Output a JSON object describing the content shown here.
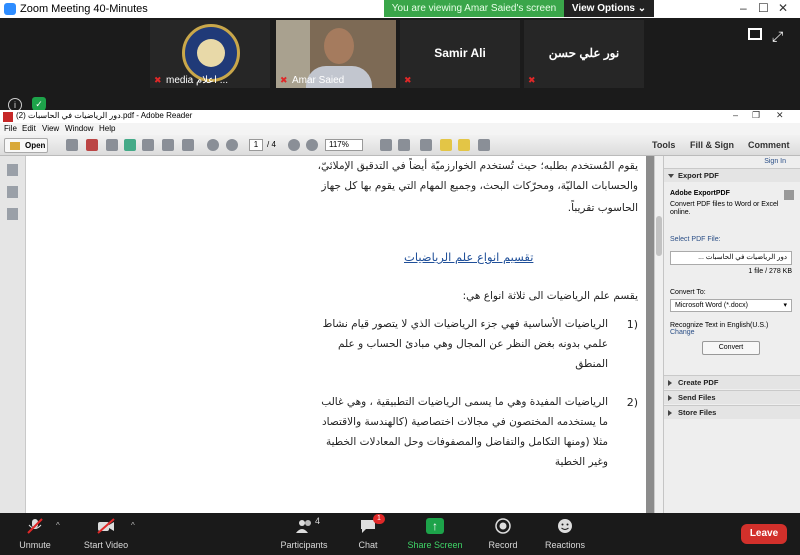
{
  "zoom": {
    "window_title": "Zoom Meeting 40-Minutes",
    "viewing_banner": "You are viewing Amar Saied's screen",
    "view_options": "View Options",
    "participants": [
      {
        "name": "media اعلام ..."
      },
      {
        "name": "Amar Saied"
      },
      {
        "name": "Samir Ali"
      },
      {
        "name": "نور علي حسن"
      }
    ],
    "controls": {
      "unmute": "Unmute",
      "start_video": "Start Video",
      "participants": "Participants",
      "participants_count": "4",
      "chat": "Chat",
      "chat_badge": "1",
      "share_screen": "Share Screen",
      "record": "Record",
      "reactions": "Reactions",
      "leave": "Leave"
    },
    "colors": {
      "banner": "#3aa64a",
      "leave": "#d2302b",
      "share": "#1da34a"
    }
  },
  "reader": {
    "title": "دور الرياضيات في الحاسبات (2).pdf - Adobe Reader",
    "menu": [
      "File",
      "Edit",
      "View",
      "Window",
      "Help"
    ],
    "toolbar": {
      "open": "Open",
      "page_current": "1",
      "page_total": "/ 4",
      "zoom": "117%",
      "tools": "Tools",
      "fill_sign": "Fill & Sign",
      "comment": "Comment"
    },
    "document": {
      "lines_top": [
        "يقوم المُستخدم بطلبه؛ حيث تُستخدم الخوارزميّة أيضاً في التدقيق الإملائيّ،",
        "والحسابات الماليّة، ومحرّكات البحث، وجميع المهام التي يقوم بها كل جهاز",
        "الحاسوب تقريباً."
      ],
      "heading": "تقسيم انواع علم الرياضيات",
      "intro": "يقسم علم الرياضيات الى ثلاثة انواع هي:",
      "item1_number": "(1",
      "item1_lines": [
        "الرياضيات الأساسية فهي جزء الرياضيات الذي لا يتصور قيام نشاط",
        "علمي بدونه بغض النظر عن المجال وهي مبادئ الحساب و علم",
        "المنطق"
      ],
      "item2_number": "(2",
      "item2_lines": [
        "الرياضيات المفيدة وهي ما يسمى الرياضيات التطبيقية ، وهي غالب",
        "ما يستخدمه المختصون في مجالات اختصاصية (كالهندسة والاقتصاد",
        "مثلا (ومنها التكامل والتفاضل والمصفوفات وحل المعادلات الخطية",
        "وغير الخطية"
      ]
    },
    "panel": {
      "sign_in": "Sign In",
      "export_pdf": "Export PDF",
      "adobe_exportpdf": "Adobe ExportPDF",
      "export_desc1": "Convert PDF files to Word or Excel",
      "export_desc2": "online.",
      "select_pdf_file": "Select PDF File:",
      "selected_file": "دور الرياضيات في الحاسبات ...",
      "file_info": "1 file / 278 KB",
      "convert_to": "Convert To:",
      "convert_option": "Microsoft Word (*.docx)",
      "recognize": "Recognize Text in English(U.S.)",
      "change": "Change",
      "convert": "Convert",
      "create_pdf": "Create PDF",
      "send_files": "Send Files",
      "store_files": "Store Files"
    }
  }
}
